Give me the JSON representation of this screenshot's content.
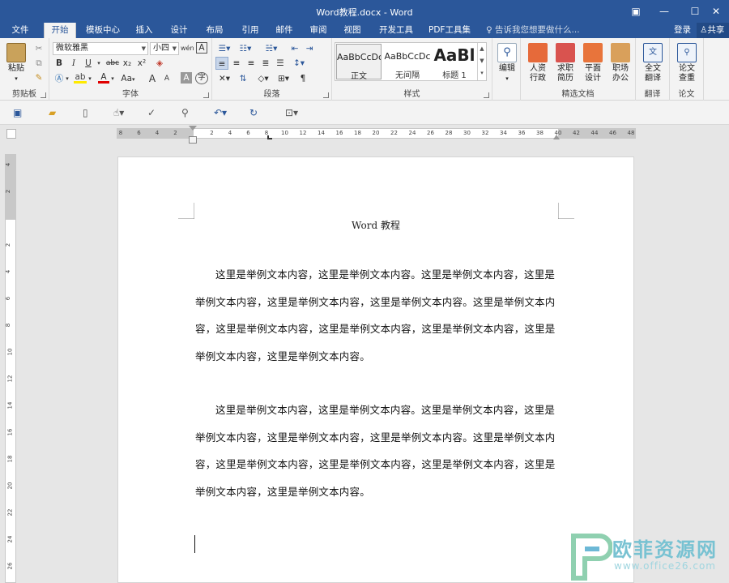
{
  "window": {
    "title": "Word教程.docx - Word"
  },
  "tabs": [
    "文件",
    "开始",
    "模板中心",
    "插入",
    "设计",
    "布局",
    "引用",
    "邮件",
    "审阅",
    "视图",
    "开发工具",
    "PDF工具集"
  ],
  "tell_me": "告诉我您想要做什么...",
  "account": {
    "login": "登录",
    "share": "共享"
  },
  "ribbon": {
    "clipboard": {
      "paste": "粘贴",
      "label": "剪贴板"
    },
    "font": {
      "name": "微软雅黑",
      "size": "小四",
      "label": "字体",
      "bold": "B",
      "italic": "I",
      "underline": "U",
      "strike": "abc",
      "sub": "x₂",
      "sup": "x²",
      "grow": "A",
      "shrink": "A",
      "case": "Aa",
      "color_a": "A",
      "phonetic": "wén",
      "border_a": "A"
    },
    "paragraph": {
      "label": "段落"
    },
    "styles": {
      "label": "样式",
      "items": [
        {
          "sample": "AaBbCcDc",
          "name": "正文"
        },
        {
          "sample": "AaBbCcDc",
          "name": "无间隔"
        },
        {
          "sample": "AaBl",
          "name": "标题 1"
        }
      ]
    },
    "editing": {
      "label": "编辑"
    },
    "templates": {
      "label": "精选文档",
      "items": [
        "人资\n行政",
        "求职\n简历",
        "平面\n设计",
        "职场\n办公"
      ]
    },
    "translate": {
      "button": "全文\n翻译",
      "label": "翻译"
    },
    "paper": {
      "button": "论文\n查重",
      "label": "论文"
    }
  },
  "ruler_h": [
    "8",
    "6",
    "4",
    "2",
    "",
    "2",
    "4",
    "6",
    "8",
    "10",
    "12",
    "14",
    "16",
    "18",
    "20",
    "22",
    "24",
    "26",
    "28",
    "30",
    "32",
    "34",
    "36",
    "38",
    "40",
    "42",
    "44",
    "46",
    "48"
  ],
  "ruler_v": [
    "4",
    "2",
    "",
    "2",
    "4",
    "6",
    "8",
    "10",
    "12",
    "14",
    "16",
    "18",
    "20",
    "22",
    "24",
    "26"
  ],
  "document": {
    "title": "Word 教程",
    "paragraphs": [
      "这里是举例文本内容，这里是举例文本内容。这里是举例文本内容，这里是举例文本内容，这里是举例文本内容，这里是举例文本内容。这里是举例文本内容，这里是举例文本内容，这里是举例文本内容，这里是举例文本内容，这里是举例文本内容，这里是举例文本内容。",
      "这里是举例文本内容，这里是举例文本内容。这里是举例文本内容，这里是举例文本内容，这里是举例文本内容，这里是举例文本内容。这里是举例文本内容，这里是举例文本内容，这里是举例文本内容，这里是举例文本内容，这里是举例文本内容，这里是举例文本内容。"
    ]
  },
  "watermark": {
    "text": "欧菲资源网",
    "url": "www.office26.com"
  },
  "colors": {
    "accent": "#2b579a",
    "ribbon": "#f3f3f3",
    "canvas": "#e6e6e6"
  }
}
